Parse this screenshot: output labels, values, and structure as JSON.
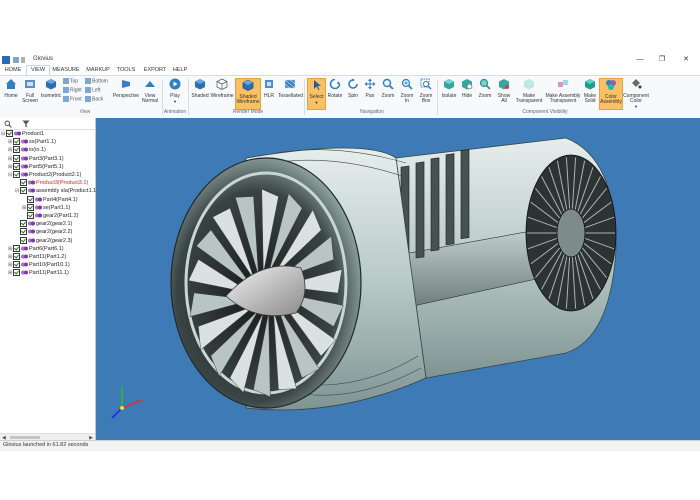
{
  "window": {
    "title": "Glovius",
    "controls": [
      "—",
      "❐",
      "✕"
    ]
  },
  "menu": {
    "tabs": [
      "HOME",
      "VIEW",
      "MEASURE",
      "MARKUP",
      "TOOLS",
      "EXPORT",
      "HELP"
    ],
    "active": "VIEW"
  },
  "ribbon": {
    "view": {
      "home": "Home",
      "full_screen": "Full\nScreen",
      "isometric": "Isometric",
      "top": "Top",
      "right": "Right",
      "front": "Front",
      "bottom": "Bottom",
      "left": "Left",
      "back": "Back",
      "perspective": "Perspective",
      "view_normal": "View\nNormal",
      "group_label": "View"
    },
    "animation": {
      "play": "Play",
      "group_label": "Animation"
    },
    "render_mode": {
      "shaded": "Shaded",
      "wireframe": "Wireframe",
      "shaded_wireframe": "Shaded\nWireframe",
      "hlr": "HLR",
      "tessellated": "Tessellated",
      "group_label": "Render Mode"
    },
    "navigation": {
      "select": "Select",
      "rotate": "Rotate",
      "spin": "Spin",
      "pan": "Pan",
      "zoom": "Zoom",
      "zoom_in": "Zoom\nIn",
      "zoom_box": "Zoom\nBox",
      "group_label": "Navigation"
    },
    "component_visibility": {
      "isolate": "Isolate",
      "hide": "Hide",
      "zoom": "Zoom",
      "show_all": "Show\nAll",
      "make_transparent": "Make\nTransparent",
      "make_assembly_transparent": "Make Assembly\nTransparent",
      "make_solid": "Make\nSolid",
      "color_assembly": "Color\nAssembly",
      "component_color": "Component\nColor",
      "group_label": "Component Visibility"
    }
  },
  "tree": {
    "nodes": [
      {
        "label": "Product1",
        "level": 0,
        "expand": "⊟",
        "red": false
      },
      {
        "label": "ss(Part1.1)",
        "level": 1,
        "expand": "⊞",
        "red": false
      },
      {
        "label": "io(io.1)",
        "level": 1,
        "expand": "⊞",
        "red": false
      },
      {
        "label": "Part3(Part3.1)",
        "level": 1,
        "expand": "⊞",
        "red": false
      },
      {
        "label": "Part5(Part5.1)",
        "level": 1,
        "expand": "⊞",
        "red": false
      },
      {
        "label": "Product2(Product2.1)",
        "level": 1,
        "expand": "⊟",
        "red": false
      },
      {
        "label": "Product3(Product3.1)",
        "level": 2,
        "expand": "",
        "red": true
      },
      {
        "label": "assembly sla(Product1.1)",
        "level": 2,
        "expand": "⊟",
        "red": false
      },
      {
        "label": "Part4(Part4.1)",
        "level": 3,
        "expand": "",
        "red": false
      },
      {
        "label": "se(Part1.1)",
        "level": 3,
        "expand": "⊞",
        "red": false
      },
      {
        "label": "gear2(Part1.2)",
        "level": 3,
        "expand": "",
        "red": false
      },
      {
        "label": "gear2(gear2.1)",
        "level": 2,
        "expand": "",
        "red": false
      },
      {
        "label": "gear2(gear2.2)",
        "level": 2,
        "expand": "",
        "red": false
      },
      {
        "label": "gear2(gear2.3)",
        "level": 2,
        "expand": "",
        "red": false
      },
      {
        "label": "Part6(Part6.1)",
        "level": 1,
        "expand": "⊞",
        "red": false
      },
      {
        "label": "Part11(Part1.2)",
        "level": 1,
        "expand": "⊞",
        "red": false
      },
      {
        "label": "Part10(Part10.1)",
        "level": 1,
        "expand": "⊞",
        "red": false
      },
      {
        "label": "Part11(Part11.1)",
        "level": 1,
        "expand": "⊞",
        "red": false
      }
    ]
  },
  "status": {
    "text": "Glovius launched in 61.82 seconds"
  },
  "colors": {
    "viewport_bg": "#3e7ab5",
    "selected_button": "#f9c066",
    "highlight_part": "#e02020"
  }
}
